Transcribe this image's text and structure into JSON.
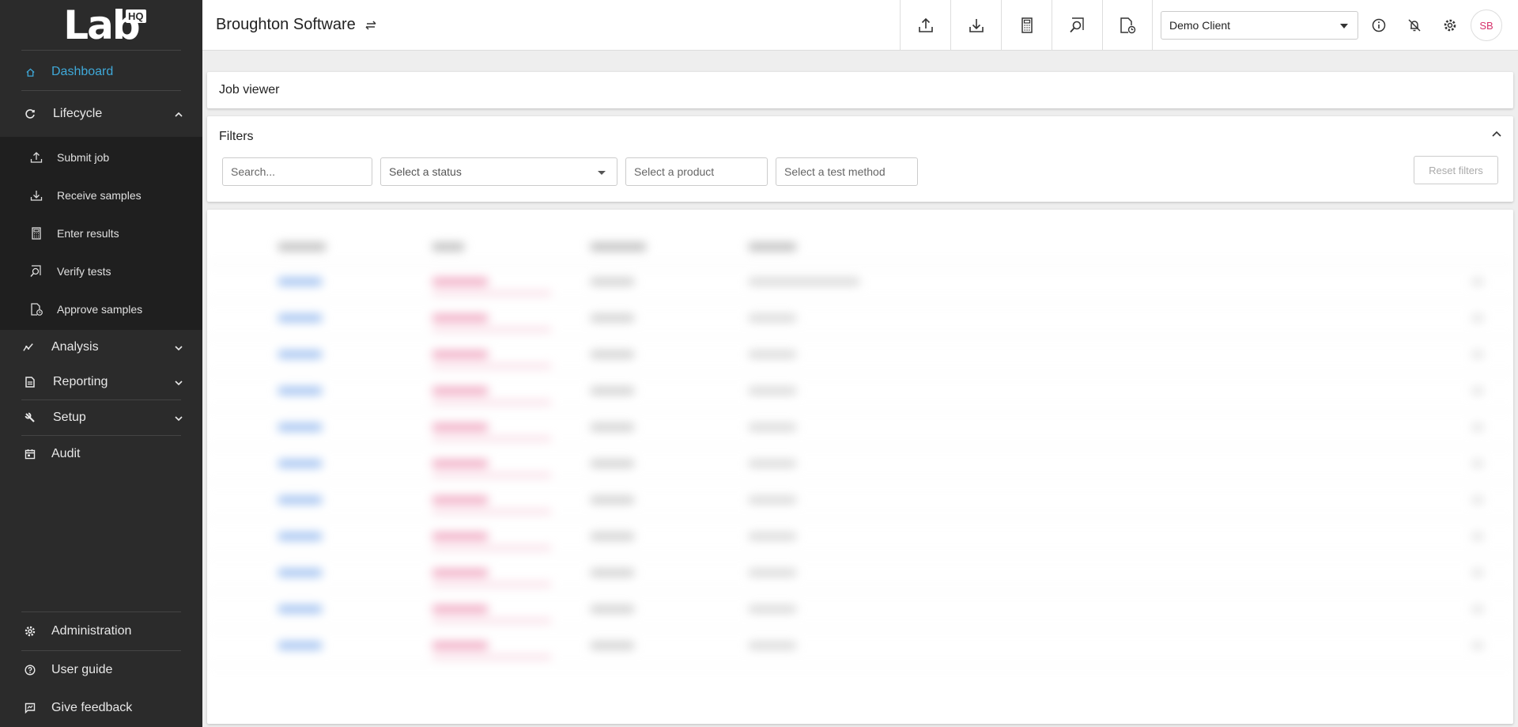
{
  "app": {
    "logo_text": "Lab",
    "logo_badge": "HQ"
  },
  "sidebar": {
    "dashboard": "Dashboard",
    "lifecycle": "Lifecycle",
    "lifecycle_items": [
      "Submit job",
      "Receive samples",
      "Enter results",
      "Verify tests",
      "Approve samples"
    ],
    "analysis": "Analysis",
    "reporting": "Reporting",
    "setup": "Setup",
    "audit": "Audit",
    "administration": "Administration",
    "user_guide": "User guide",
    "give_feedback": "Give feedback"
  },
  "topbar": {
    "company": "Broughton Software",
    "client": "Demo Client",
    "avatar_initials": "SB"
  },
  "job_viewer": {
    "title": "Job viewer"
  },
  "filters": {
    "title": "Filters",
    "search_placeholder": "Search...",
    "status_placeholder": "Select a status",
    "product_placeholder": "Select a product",
    "test_method_placeholder": "Select a test method",
    "reset_label": "Reset filters"
  },
  "colors": {
    "sidebar_bg": "#2b2b2b",
    "accent": "#3fa9d9",
    "avatar_text": "#d6336c"
  }
}
